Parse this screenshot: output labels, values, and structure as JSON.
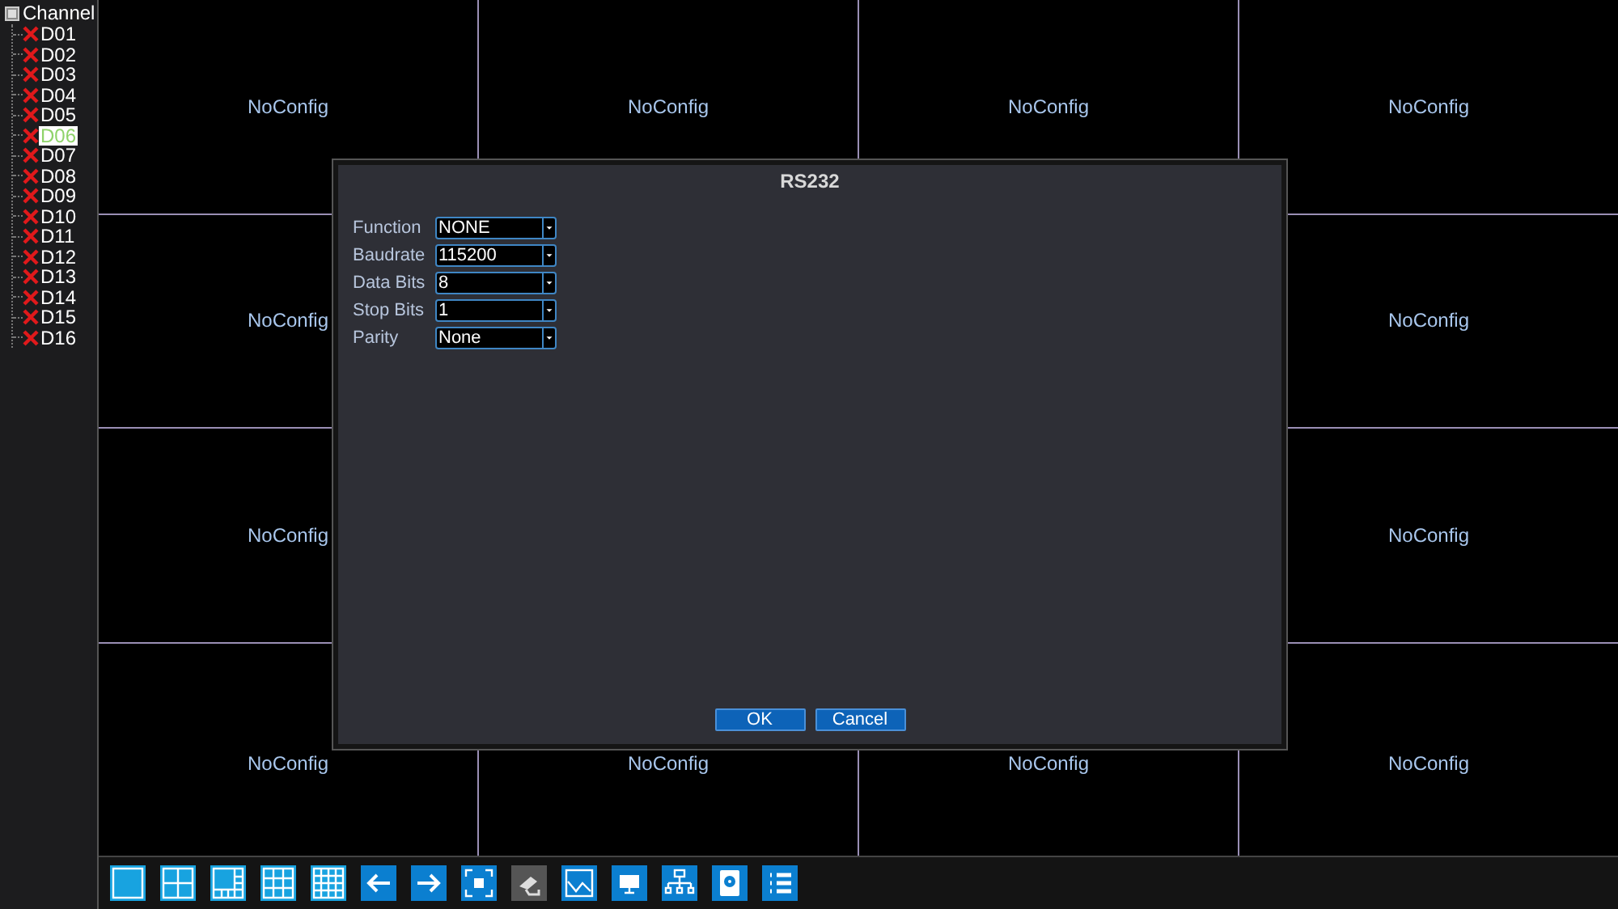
{
  "channel_tree": {
    "title": "Channel",
    "items": [
      {
        "label": "D01",
        "selected": false
      },
      {
        "label": "D02",
        "selected": false
      },
      {
        "label": "D03",
        "selected": false
      },
      {
        "label": "D04",
        "selected": false
      },
      {
        "label": "D05",
        "selected": false
      },
      {
        "label": "D06",
        "selected": true
      },
      {
        "label": "D07",
        "selected": false
      },
      {
        "label": "D08",
        "selected": false
      },
      {
        "label": "D09",
        "selected": false
      },
      {
        "label": "D10",
        "selected": false
      },
      {
        "label": "D11",
        "selected": false
      },
      {
        "label": "D12",
        "selected": false
      },
      {
        "label": "D13",
        "selected": false
      },
      {
        "label": "D14",
        "selected": false
      },
      {
        "label": "D15",
        "selected": false
      },
      {
        "label": "D16",
        "selected": false
      }
    ]
  },
  "video_grid": [
    {
      "kind": "tile",
      "label": "NoConfig"
    },
    {
      "kind": "tile",
      "label": "NoConfig"
    },
    {
      "kind": "tile",
      "label": "NoConfig"
    },
    {
      "kind": "tile",
      "label": "NoConfig"
    },
    {
      "kind": "tile",
      "label": "NoConfig"
    },
    {
      "kind": "blank"
    },
    {
      "kind": "blank"
    },
    {
      "kind": "tile",
      "label": "NoConfig"
    },
    {
      "kind": "tile",
      "label": "NoConfig"
    },
    {
      "kind": "blank"
    },
    {
      "kind": "blank"
    },
    {
      "kind": "tile",
      "label": "NoConfig"
    },
    {
      "kind": "tile",
      "label": "NoConfig"
    },
    {
      "kind": "tile",
      "label": "NoConfig"
    },
    {
      "kind": "tile",
      "label": "NoConfig"
    },
    {
      "kind": "tile",
      "label": "NoConfig"
    }
  ],
  "dialog": {
    "title": "RS232",
    "fields": [
      {
        "label": "Function",
        "value": "NONE"
      },
      {
        "label": "Baudrate",
        "value": "115200"
      },
      {
        "label": "Data Bits",
        "value": "8"
      },
      {
        "label": "Stop Bits",
        "value": "1"
      },
      {
        "label": "Parity",
        "value": "None"
      }
    ],
    "buttons": [
      "OK",
      "Cancel"
    ]
  },
  "toolbar": [
    {
      "kind": "single",
      "disabled": false
    },
    {
      "kind": "quad",
      "disabled": false
    },
    {
      "kind": "eight",
      "disabled": false
    },
    {
      "kind": "nine",
      "disabled": false
    },
    {
      "kind": "sixteen",
      "disabled": false
    },
    {
      "kind": "prev",
      "disabled": false
    },
    {
      "kind": "next",
      "disabled": false
    },
    {
      "kind": "fullscreen",
      "disabled": false
    },
    {
      "kind": "camera",
      "disabled": true
    },
    {
      "kind": "chart",
      "disabled": false
    },
    {
      "kind": "monitor",
      "disabled": false
    },
    {
      "kind": "network",
      "disabled": false
    },
    {
      "kind": "disk",
      "disabled": false
    },
    {
      "kind": "list",
      "disabled": false
    }
  ]
}
